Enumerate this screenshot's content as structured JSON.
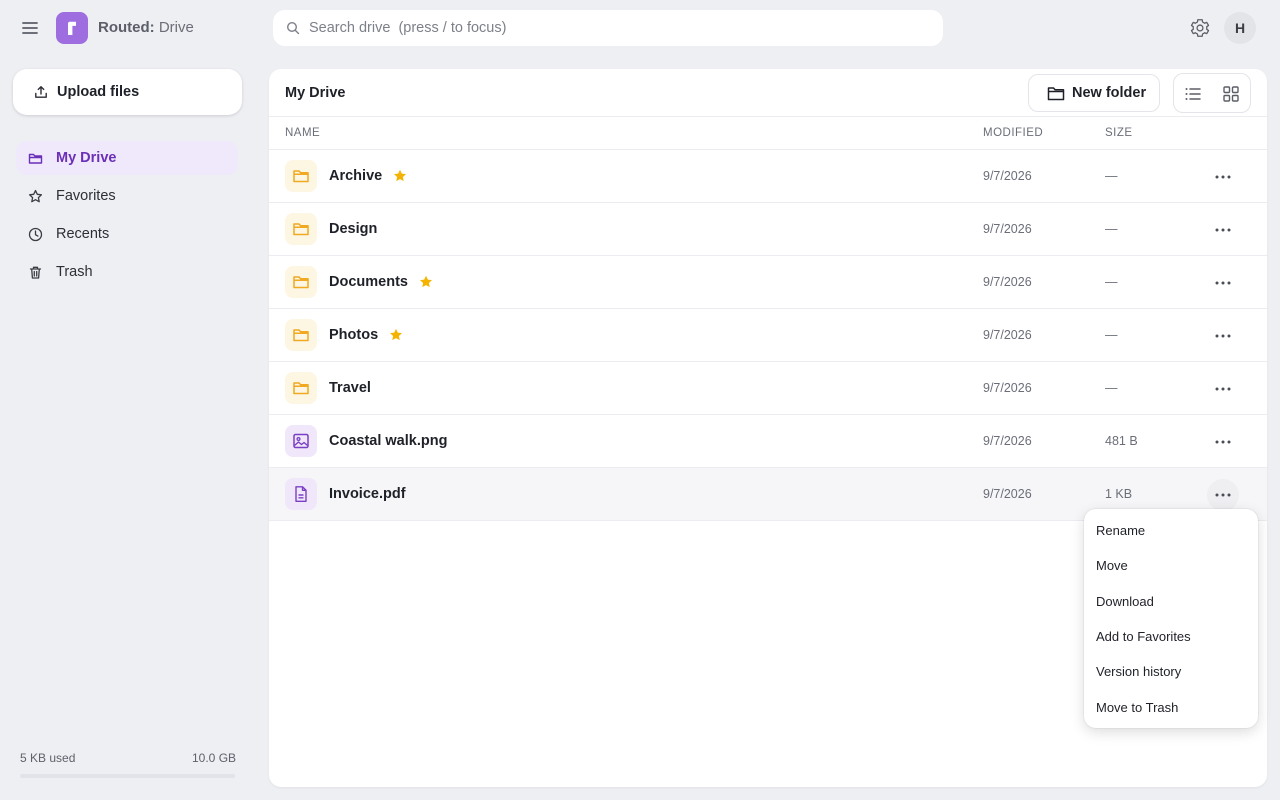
{
  "app": {
    "name_bold": "Routed:",
    "name_rest": " Drive"
  },
  "search": {
    "placeholder": "Search drive  (press / to focus)",
    "value": ""
  },
  "user": {
    "initial": "H"
  },
  "sidebar": {
    "upload_label": "Upload files",
    "items": [
      {
        "label": "My Drive",
        "icon": "folder-icon",
        "active": true
      },
      {
        "label": "Favorites",
        "icon": "star-icon",
        "active": false
      },
      {
        "label": "Recents",
        "icon": "clock-icon",
        "active": false
      },
      {
        "label": "Trash",
        "icon": "trash-icon",
        "active": false
      }
    ],
    "storage": {
      "used": "5 KB used",
      "total": "10.0 GB",
      "fraction": 5e-07
    }
  },
  "main": {
    "title": "My Drive",
    "new_folder_label": "New folder",
    "columns": {
      "name": "Name",
      "modified": "Modified",
      "size": "Size"
    },
    "rows": [
      {
        "name": "Archive",
        "type": "folder",
        "starred": true,
        "modified": "9/7/2026",
        "size": "—"
      },
      {
        "name": "Design",
        "type": "folder",
        "starred": false,
        "modified": "9/7/2026",
        "size": "—"
      },
      {
        "name": "Documents",
        "type": "folder",
        "starred": true,
        "modified": "9/7/2026",
        "size": "—"
      },
      {
        "name": "Photos",
        "type": "folder",
        "starred": true,
        "modified": "9/7/2026",
        "size": "—"
      },
      {
        "name": "Travel",
        "type": "folder",
        "starred": false,
        "modified": "9/7/2026",
        "size": "—"
      },
      {
        "name": "Coastal walk.png",
        "type": "image",
        "starred": false,
        "modified": "9/7/2026",
        "size": "481 B"
      },
      {
        "name": "Invoice.pdf",
        "type": "document",
        "starred": false,
        "modified": "9/7/2026",
        "size": "1 KB"
      }
    ]
  },
  "context_menu": {
    "items": [
      "Rename",
      "Move",
      "Download",
      "Add to Favorites",
      "Version history",
      "Move to Trash"
    ]
  },
  "colors": {
    "accent": "#9e6ee0",
    "star": "#f5b301",
    "folder": "#f0a920",
    "file_icon": "#7b3fc4"
  }
}
